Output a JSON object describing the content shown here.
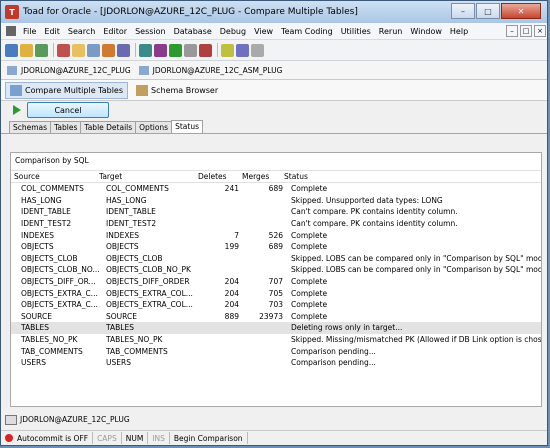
{
  "window": {
    "title": "Toad for Oracle - [JDORLON@AZURE_12C_PLUG - Compare Multiple Tables]"
  },
  "menu": [
    "File",
    "Edit",
    "Search",
    "Editor",
    "Session",
    "Database",
    "Debug",
    "View",
    "Team Coding",
    "Utilities",
    "Rerun",
    "Window",
    "Help"
  ],
  "connections": [
    "JDORLON@AZURE_12C_PLUG",
    "JDORLON@AZURE_12C_ASM_PLUG"
  ],
  "documents": [
    "Compare Multiple Tables",
    "Schema Browser"
  ],
  "cancel_label": "Cancel",
  "tabs": [
    "Schemas",
    "Tables",
    "Table Details",
    "Options",
    "Status"
  ],
  "active_tab": "Status",
  "group_label": "Comparison by SQL",
  "columns": {
    "source": "Source",
    "target": "Target",
    "deletes": "Deletes",
    "merges": "Merges",
    "status": "Status"
  },
  "rows": [
    {
      "source": "COL_COMMENTS",
      "target": "COL_COMMENTS",
      "deletes": "241",
      "merges": "689",
      "status": "Complete"
    },
    {
      "source": "HAS_LONG",
      "target": "HAS_LONG",
      "deletes": "",
      "merges": "",
      "status": "Skipped.  Unsupported data types: LONG"
    },
    {
      "source": "IDENT_TABLE",
      "target": "IDENT_TABLE",
      "deletes": "",
      "merges": "",
      "status": "Can't compare.  PK contains identity column."
    },
    {
      "source": "IDENT_TEST2",
      "target": "IDENT_TEST2",
      "deletes": "",
      "merges": "",
      "status": "Can't compare.  PK contains identity column."
    },
    {
      "source": "INDEXES",
      "target": "INDEXES",
      "deletes": "7",
      "merges": "526",
      "status": "Complete"
    },
    {
      "source": "OBJECTS",
      "target": "OBJECTS",
      "deletes": "199",
      "merges": "689",
      "status": "Complete"
    },
    {
      "source": "OBJECTS_CLOB",
      "target": "OBJECTS_CLOB",
      "deletes": "",
      "merges": "",
      "status": "Skipped.  LOBS can be compared only in \"Comparison by SQL\" mode and when ..."
    },
    {
      "source": "OBJECTS_CLOB_NO...",
      "target": "OBJECTS_CLOB_NO_PK",
      "deletes": "",
      "merges": "",
      "status": "Skipped.  LOBS can be compared only in \"Comparison by SQL\" mode and when ..."
    },
    {
      "source": "OBJECTS_DIFF_OR...",
      "target": "OBJECTS_DIFF_ORDER",
      "deletes": "204",
      "merges": "707",
      "status": "Complete"
    },
    {
      "source": "OBJECTS_EXTRA_C...",
      "target": "OBJECTS_EXTRA_COL...",
      "deletes": "204",
      "merges": "705",
      "status": "Complete"
    },
    {
      "source": "OBJECTS_EXTRA_C...",
      "target": "OBJECTS_EXTRA_COL...",
      "deletes": "204",
      "merges": "703",
      "status": "Complete"
    },
    {
      "source": "SOURCE",
      "target": "SOURCE",
      "deletes": "889",
      "merges": "23973",
      "status": "Complete"
    },
    {
      "source": "TABLES",
      "target": "TABLES",
      "deletes": "",
      "merges": "",
      "status": "Deleting rows only in target..."
    },
    {
      "source": "TABLES_NO_PK",
      "target": "TABLES_NO_PK",
      "deletes": "",
      "merges": "",
      "status": "Skipped.  Missing/mismatched PK (Allowed if DB Link option is chosen)"
    },
    {
      "source": "TAB_COMMENTS",
      "target": "TAB_COMMENTS",
      "deletes": "",
      "merges": "",
      "status": "Comparison pending..."
    },
    {
      "source": "USERS",
      "target": "USERS",
      "deletes": "",
      "merges": "",
      "status": "Comparison pending..."
    }
  ],
  "selected_row": 12,
  "connection_status": "JDORLON@AZURE_12C_PLUG",
  "statusbar": {
    "autocommit": "Autocommit is OFF",
    "caps": "CAPS",
    "num": "NUM",
    "ins": "INS",
    "message": "Begin Comparison"
  }
}
